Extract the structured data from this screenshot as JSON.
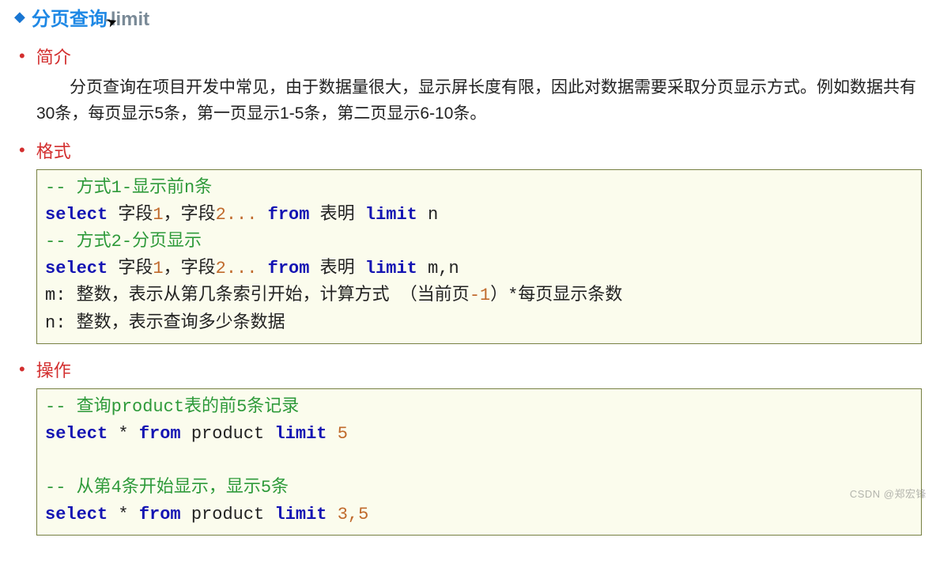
{
  "title": {
    "bullet": "◆",
    "main": "分页查询",
    "suffix": "-limit"
  },
  "sections": {
    "intro": {
      "heading": "简介",
      "paragraph": "分页查询在项目开发中常见，由于数据量很大，显示屏长度有限，因此对数据需要采取分页显示方式。例如数据共有30条，每页显示5条，第一页显示1-5条，第二页显示6-10条。"
    },
    "format": {
      "heading": "格式",
      "code": {
        "l1_a": "-- ",
        "l1_b": "方式",
        "l1_c": "1-",
        "l1_d": "显示前",
        "l1_e": "n",
        "l1_f": "条",
        "l2_a": "select",
        "l2_b": " 字段",
        "l2_c": "1",
        "l2_d": "，字段",
        "l2_e": "2... ",
        "l2_f": "from",
        "l2_g": " 表明 ",
        "l2_h": "limit",
        "l2_i": " n",
        "l3_a": "-- ",
        "l3_b": "方式",
        "l3_c": "2-",
        "l3_d": "分页显示",
        "l4_a": "select",
        "l4_b": " 字段",
        "l4_c": "1",
        "l4_d": "，字段",
        "l4_e": "2... ",
        "l4_f": "from",
        "l4_g": " 表明 ",
        "l4_h": "limit",
        "l4_i": " m,n",
        "l5_a": "m: 整数，表示从第几条索引开始，计算方式 （当前页",
        "l5_b": "-1",
        "l5_c": "）*每页显示条数",
        "l6": "n: 整数，表示查询多少条数据"
      }
    },
    "op": {
      "heading": "操作",
      "code": {
        "l1_a": "-- ",
        "l1_b": "查询",
        "l1_c": "product",
        "l1_d": "表的前",
        "l1_e": "5",
        "l1_f": "条记录",
        "l2_a": "select",
        "l2_b": " * ",
        "l2_c": "from",
        "l2_d": " product ",
        "l2_e": "limit",
        "l2_f": " ",
        "l2_g": "5",
        "l3": " ",
        "l4_a": "-- ",
        "l4_b": "从第",
        "l4_c": "4",
        "l4_d": "条开始显示，显示",
        "l4_e": "5",
        "l4_f": "条",
        "l5_a": "select",
        "l5_b": " * ",
        "l5_c": "from",
        "l5_d": " product ",
        "l5_e": "limit",
        "l5_f": " ",
        "l5_g": "3,5"
      }
    }
  },
  "watermark": "CSDN @郑宏锋"
}
